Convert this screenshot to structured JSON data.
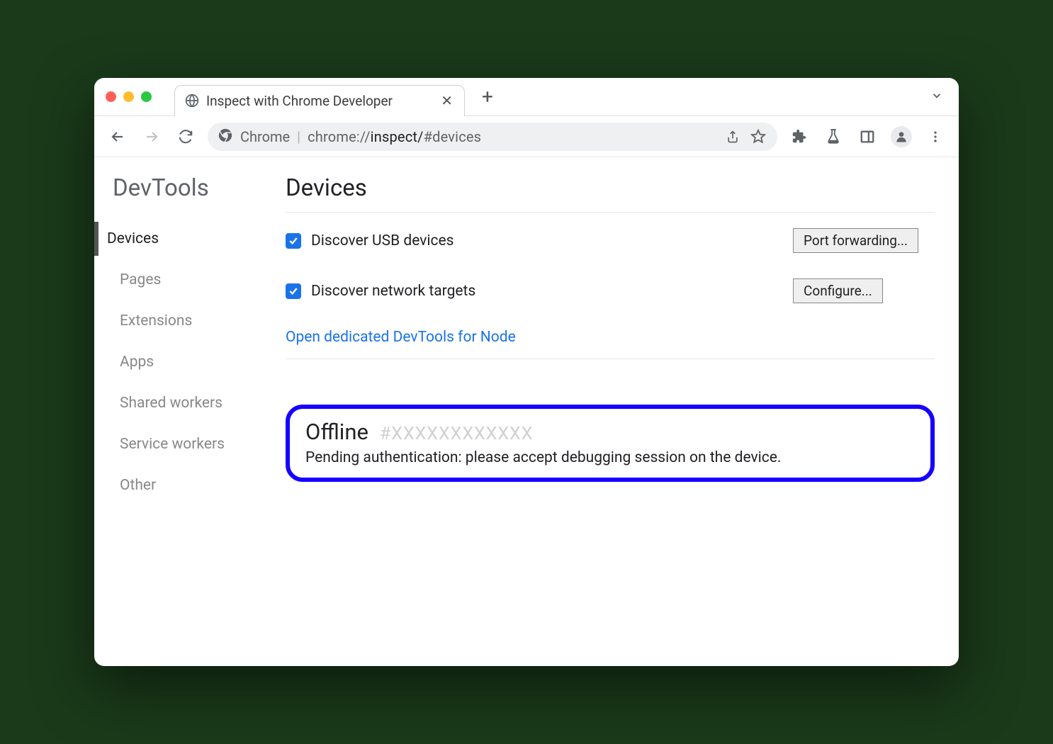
{
  "browser": {
    "tab_title": "Inspect with Chrome Developer",
    "origin_label": "Chrome",
    "url_scheme": "chrome://",
    "url_path": "inspect/",
    "url_hash": "#devices"
  },
  "sidebar": {
    "title": "DevTools",
    "items": [
      {
        "label": "Devices",
        "active": true
      },
      {
        "label": "Pages",
        "active": false
      },
      {
        "label": "Extensions",
        "active": false
      },
      {
        "label": "Apps",
        "active": false
      },
      {
        "label": "Shared workers",
        "active": false
      },
      {
        "label": "Service workers",
        "active": false
      },
      {
        "label": "Other",
        "active": false
      }
    ]
  },
  "main": {
    "title": "Devices",
    "discover_usb_label": "Discover USB devices",
    "port_forwarding_btn": "Port forwarding...",
    "discover_network_label": "Discover network targets",
    "configure_btn": "Configure...",
    "node_link": "Open dedicated DevTools for Node",
    "device": {
      "status": "Offline",
      "id": "#XXXXXXXXXXXX",
      "message": "Pending authentication: please accept debugging session on the device."
    }
  }
}
